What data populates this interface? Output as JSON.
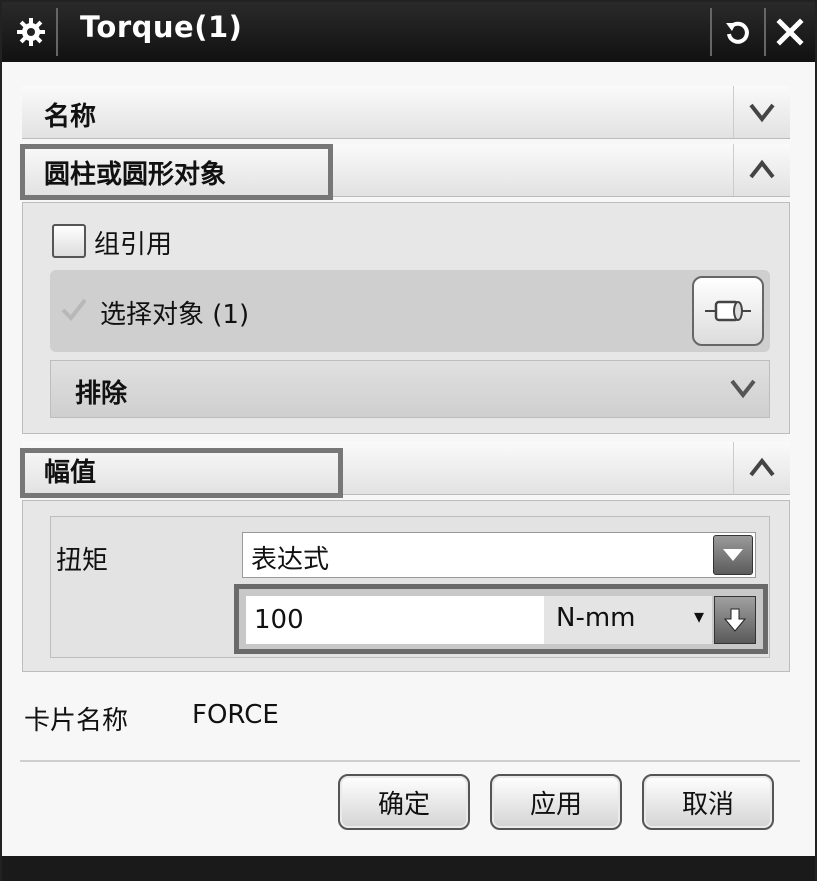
{
  "window": {
    "title": "Torque(1)"
  },
  "sections": {
    "name": {
      "label": "名称"
    },
    "cylinder_object": {
      "label": "圆柱或圆形对象"
    },
    "magnitude": {
      "label": "幅值"
    }
  },
  "cylinder": {
    "group_reference_label": "组引用",
    "select_object_label": "选择对象 (1)",
    "exclude_label": "排除"
  },
  "magnitude": {
    "torque_label": "扭矩",
    "type_selected": "表达式",
    "value": "100",
    "unit": "N-mm"
  },
  "card": {
    "label": "卡片名称",
    "value": "FORCE"
  },
  "buttons": {
    "ok": "确定",
    "apply": "应用",
    "cancel": "取消"
  },
  "icons": {
    "title": "gear-icon",
    "reset": "reset-icon",
    "close": "close-icon",
    "select": "cylinder-icon"
  }
}
